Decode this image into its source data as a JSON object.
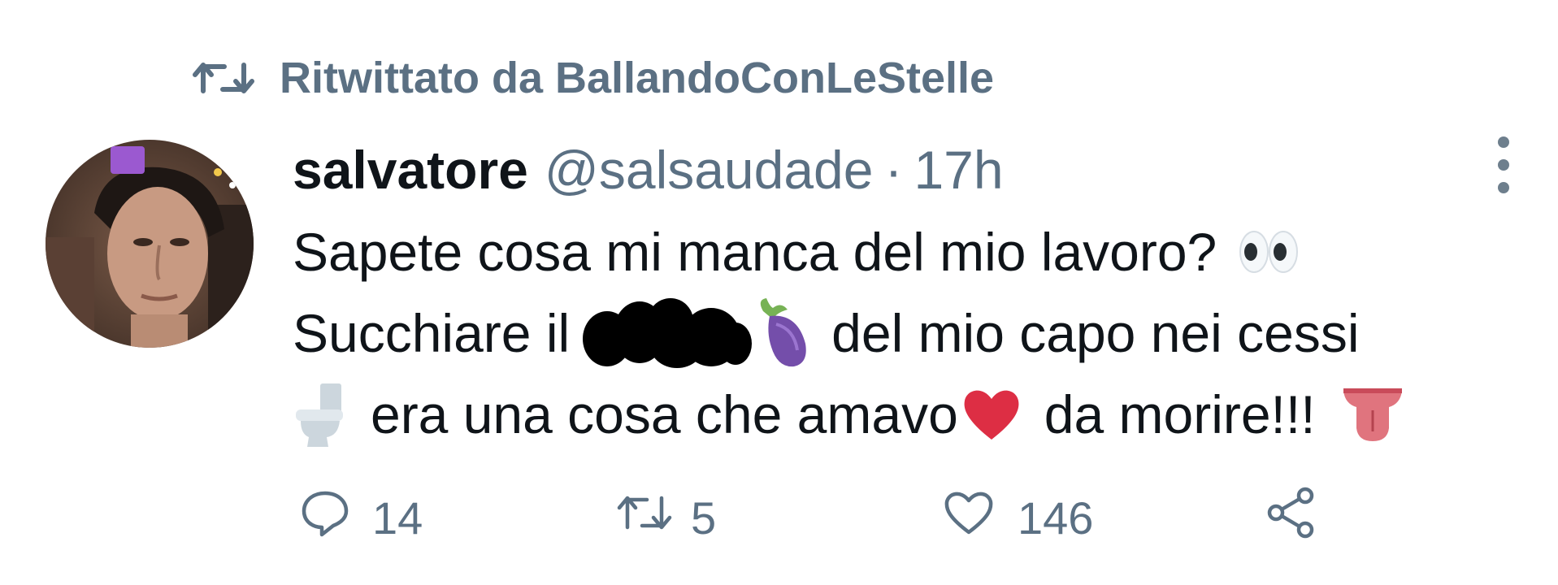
{
  "retweet": {
    "icon": "retweet-icon",
    "text": "Ritwittato da BallandoConLeStelle"
  },
  "author": {
    "display_name": "salvatore",
    "handle": "@salsaudade",
    "separator": "·",
    "time": "17h"
  },
  "more_icon": "more-vertical-icon",
  "body": {
    "line1": "Sapete cosa mi manca del mio lavoro?",
    "line2_a": "Succhiare il",
    "line2_b": "del mio capo nei cessi",
    "line3_a": "era una cosa che amavo",
    "line3_b": "da morire!!!",
    "emojis": [
      "eyes-emoji",
      "eggplant-emoji",
      "toilet-emoji",
      "red-heart-emoji",
      "tongue-emoji"
    ],
    "redaction": "black-scribble-redaction"
  },
  "actions": {
    "reply": {
      "icon": "reply-icon",
      "count": "14"
    },
    "retweet": {
      "icon": "retweet-icon",
      "count": "5"
    },
    "like": {
      "icon": "heart-icon",
      "count": "146"
    },
    "share": {
      "icon": "share-icon"
    }
  },
  "colors": {
    "secondary_text": "#5b7083",
    "primary_text": "#0f1419",
    "heart": "#dd2e44",
    "eggplant": "#744eaa"
  }
}
